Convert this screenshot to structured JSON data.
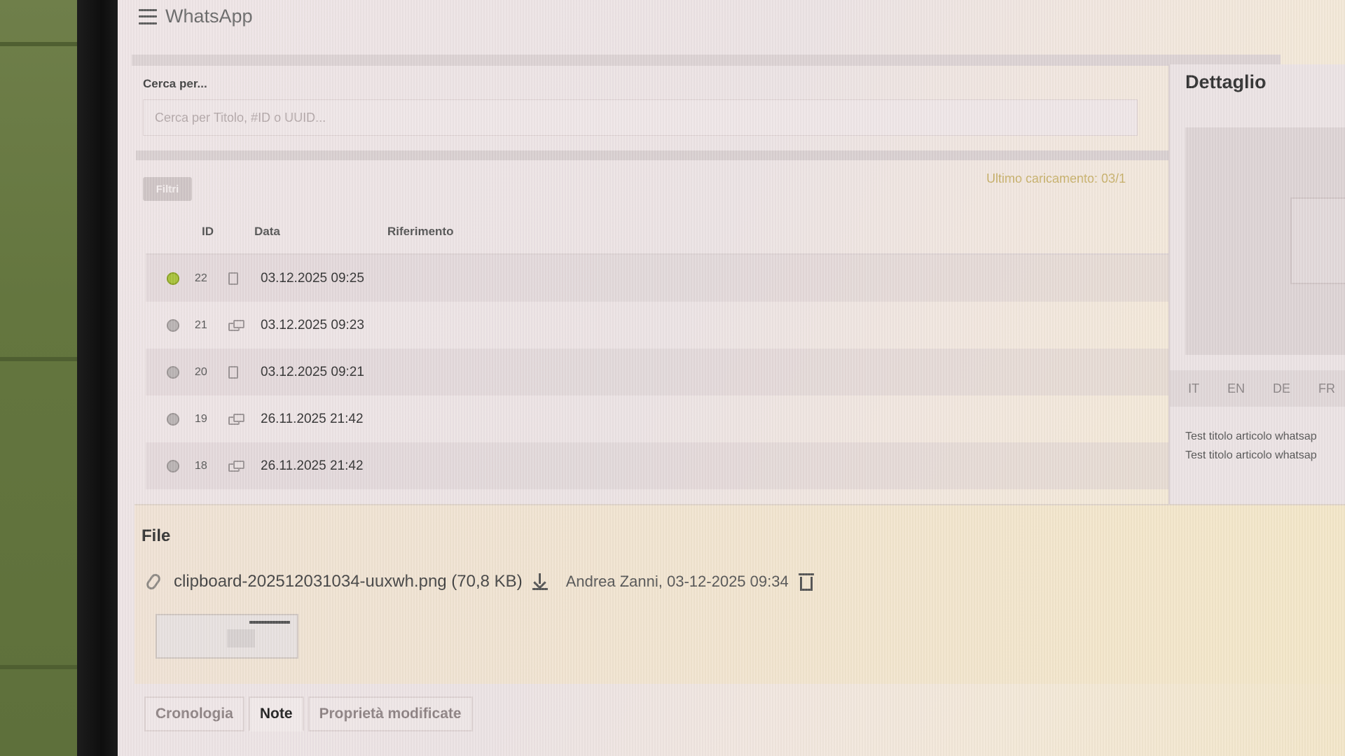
{
  "header": {
    "title": "WhatsApp",
    "icon": "list-menu-icon"
  },
  "search": {
    "label": "Cerca per...",
    "placeholder": "Cerca per Titolo, #ID o UUID..."
  },
  "filter_chip": "Filtri",
  "last_load": "Ultimo caricamento: 03/1",
  "table": {
    "columns": [
      "ID",
      "Data",
      "Riferimento"
    ],
    "rows": [
      {
        "status": "active",
        "id": "22",
        "icon": "document-icon",
        "date": "03.12.2025 09:25",
        "ref": ""
      },
      {
        "status": "inactive",
        "id": "21",
        "icon": "cards-icon",
        "date": "03.12.2025 09:23",
        "ref": ""
      },
      {
        "status": "inactive",
        "id": "20",
        "icon": "document-icon",
        "date": "03.12.2025 09:21",
        "ref": ""
      },
      {
        "status": "inactive",
        "id": "19",
        "icon": "cards-icon",
        "date": "26.11.2025 21:42",
        "ref": ""
      },
      {
        "status": "inactive",
        "id": "18",
        "icon": "cards-icon",
        "date": "26.11.2025 21:42",
        "ref": ""
      }
    ]
  },
  "detail": {
    "title": "Dettaglio",
    "languages": [
      "IT",
      "EN",
      "DE",
      "FR"
    ],
    "lines": [
      "Test titolo articolo whatsap",
      "Test titolo articolo whatsap"
    ]
  },
  "file": {
    "heading": "File",
    "name": "clipboard-202512031034-uuxwh.png (70,8 KB)",
    "meta": "Andrea Zanni, 03-12-2025 09:34"
  },
  "tabs": [
    {
      "label": "Cronologia",
      "active": false
    },
    {
      "label": "Note",
      "active": true
    },
    {
      "label": "Proprietà modificate",
      "active": false
    }
  ],
  "colors": {
    "active_status": "#a8c23a",
    "inactive_status": "#b9b3b3",
    "accent_text": "#c8b16b"
  }
}
